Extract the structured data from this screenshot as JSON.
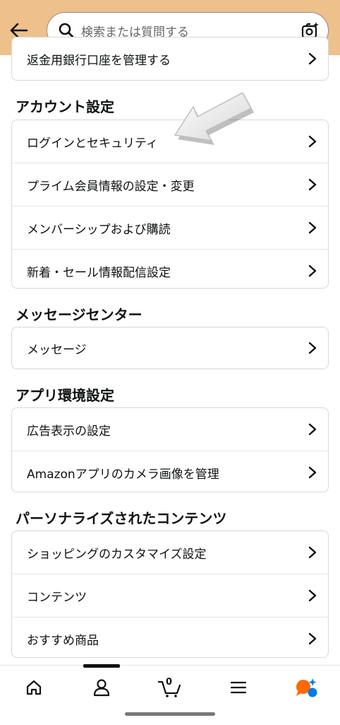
{
  "search": {
    "placeholder": "検索または質問する"
  },
  "top_card": {
    "items": [
      {
        "label": "返金用銀行口座を管理する"
      }
    ]
  },
  "sections": [
    {
      "title": "アカウント設定",
      "items": [
        {
          "label": "ログインとセキュリティ"
        },
        {
          "label": "プライム会員情報の設定・変更"
        },
        {
          "label": "メンバーシップおよび購読"
        },
        {
          "label": "新着・セール情報配信設定"
        }
      ]
    },
    {
      "title": "メッセージセンター",
      "items": [
        {
          "label": "メッセージ"
        }
      ]
    },
    {
      "title": "アプリ環境設定",
      "items": [
        {
          "label": "広告表示の設定"
        },
        {
          "label": "Amazonアプリのカメラ画像を管理"
        }
      ]
    },
    {
      "title": "パーソナライズされたコンテンツ",
      "items": [
        {
          "label": "ショッピングのカスタマイズ設定"
        },
        {
          "label": "コンテンツ"
        },
        {
          "label": "おすすめ商品"
        }
      ]
    }
  ],
  "bottom_nav": {
    "cart_count": "0",
    "items": [
      "home-icon",
      "account-icon",
      "cart-icon",
      "menu-icon",
      "ai-assistant-icon"
    ]
  },
  "colors": {
    "header": "#eec08c",
    "accent": "#ff6a00",
    "assistant_blue": "#0a7ae6"
  }
}
